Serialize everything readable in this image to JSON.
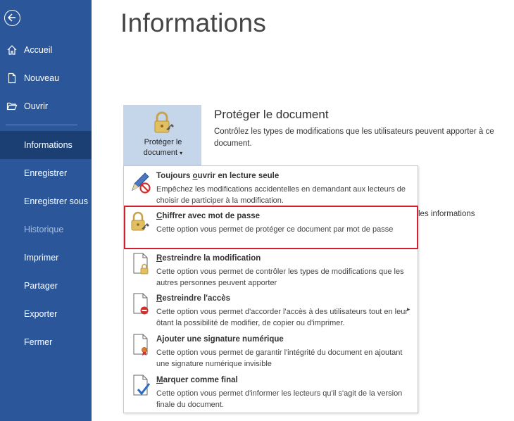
{
  "sidebar": {
    "back_icon": "back-arrow-icon",
    "items": [
      {
        "label": "Accueil",
        "icon": "home-icon"
      },
      {
        "label": "Nouveau",
        "icon": "new-document-icon"
      },
      {
        "label": "Ouvrir",
        "icon": "folder-open-icon"
      },
      {
        "label": "Informations",
        "active": true
      },
      {
        "label": "Enregistrer"
      },
      {
        "label": "Enregistrer sous"
      },
      {
        "label": "Historique",
        "disabled": true
      },
      {
        "label": "Imprimer"
      },
      {
        "label": "Partager"
      },
      {
        "label": "Exporter"
      },
      {
        "label": "Fermer"
      }
    ]
  },
  "main": {
    "title": "Informations",
    "protect_button": {
      "line1": "Protéger le",
      "line2": "document",
      "icon": "lock-key-icon"
    },
    "section_title": "Protéger le document",
    "section_desc": "Contrôlez les types de modifications que les utilisateurs peuvent apporter à ce document.",
    "behind_text": "les informations"
  },
  "menu": {
    "items": [
      {
        "title_underline": "o",
        "title_before": "Toujours ",
        "title_after": "uvrir en lecture seule",
        "desc": "Empêchez les modifications accidentelles en demandant aux lecteurs de choisir de participer à la modification.",
        "icon": "pencil-no-icon"
      },
      {
        "title_underline": "C",
        "title_before": "",
        "title_after": "hiffrer avec mot de passe",
        "desc": "Cette option vous permet de protéger ce document par mot de passe",
        "icon": "lock-key-icon"
      },
      {
        "title_underline": "R",
        "title_before": "",
        "title_after": "estreindre la modification",
        "desc": "Cette option vous permet de contrôler les types de modifications que les autres personnes peuvent apporter",
        "icon": "document-lock-icon"
      },
      {
        "title_underline": "R",
        "title_before": "",
        "title_after": "estreindre l'accès",
        "desc": "Cette option vous permet d'accorder l'accès à des utilisateurs tout en leur ôtant la possibilité de modifier, de copier ou d'imprimer.",
        "icon": "document-restricted-icon"
      },
      {
        "title_underline": "",
        "title_before": "Ajouter une signature numérique",
        "title_after": "",
        "desc": "Cette option vous permet de garantir l'intégrité du document en ajoutant une signature numérique invisible",
        "icon": "document-ribbon-icon"
      },
      {
        "title_underline": "M",
        "title_before": "",
        "title_after": "arquer comme final",
        "desc": "Cette option vous permet d'informer les lecteurs qu'il s'agit de la version finale du document.",
        "icon": "document-check-icon"
      }
    ]
  },
  "colors": {
    "sidebar": "#2b579a",
    "sidebar_active": "#1c3f73",
    "highlight": "#d32030",
    "button_bg": "#c5d5ea"
  }
}
